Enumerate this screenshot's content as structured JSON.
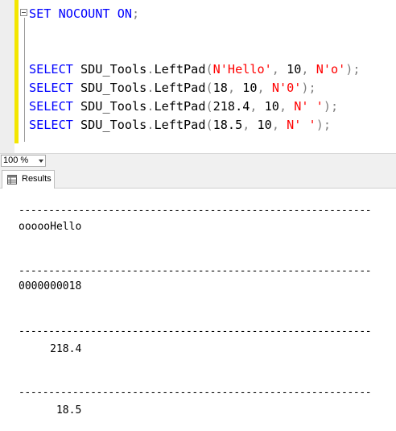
{
  "editor": {
    "lines": [
      {
        "id": "l0",
        "tokens": [
          {
            "t": "SET NOCOUNT ON",
            "c": "kw"
          },
          {
            "t": ";",
            "c": "op"
          }
        ]
      },
      {
        "id": "l1",
        "tokens": [
          {
            "t": "SELECT ",
            "c": "kw"
          },
          {
            "t": "SDU_Tools",
            "c": "num"
          },
          {
            "t": ".",
            "c": "op"
          },
          {
            "t": "LeftPad",
            "c": "num"
          },
          {
            "t": "(",
            "c": "op"
          },
          {
            "t": "N'Hello'",
            "c": "str"
          },
          {
            "t": ", ",
            "c": "op"
          },
          {
            "t": "10",
            "c": "num"
          },
          {
            "t": ", ",
            "c": "op"
          },
          {
            "t": "N'o'",
            "c": "str"
          },
          {
            "t": ");",
            "c": "op"
          }
        ]
      },
      {
        "id": "l2",
        "tokens": [
          {
            "t": "SELECT ",
            "c": "kw"
          },
          {
            "t": "SDU_Tools",
            "c": "num"
          },
          {
            "t": ".",
            "c": "op"
          },
          {
            "t": "LeftPad",
            "c": "num"
          },
          {
            "t": "(",
            "c": "op"
          },
          {
            "t": "18",
            "c": "num"
          },
          {
            "t": ", ",
            "c": "op"
          },
          {
            "t": "10",
            "c": "num"
          },
          {
            "t": ", ",
            "c": "op"
          },
          {
            "t": "N'0'",
            "c": "str"
          },
          {
            "t": ");",
            "c": "op"
          }
        ]
      },
      {
        "id": "l3",
        "tokens": [
          {
            "t": "SELECT ",
            "c": "kw"
          },
          {
            "t": "SDU_Tools",
            "c": "num"
          },
          {
            "t": ".",
            "c": "op"
          },
          {
            "t": "LeftPad",
            "c": "num"
          },
          {
            "t": "(",
            "c": "op"
          },
          {
            "t": "218.4",
            "c": "num"
          },
          {
            "t": ", ",
            "c": "op"
          },
          {
            "t": "10",
            "c": "num"
          },
          {
            "t": ", ",
            "c": "op"
          },
          {
            "t": "N' '",
            "c": "str"
          },
          {
            "t": ");",
            "c": "op"
          }
        ]
      },
      {
        "id": "l4",
        "tokens": [
          {
            "t": "SELECT ",
            "c": "kw"
          },
          {
            "t": "SDU_Tools",
            "c": "num"
          },
          {
            "t": ".",
            "c": "op"
          },
          {
            "t": "LeftPad",
            "c": "num"
          },
          {
            "t": "(",
            "c": "op"
          },
          {
            "t": "18.5",
            "c": "num"
          },
          {
            "t": ", ",
            "c": "op"
          },
          {
            "t": "10",
            "c": "num"
          },
          {
            "t": ", ",
            "c": "op"
          },
          {
            "t": "N' '",
            "c": "str"
          },
          {
            "t": ");",
            "c": "op"
          }
        ]
      }
    ]
  },
  "zoom": {
    "value": "100 %"
  },
  "results_tab": {
    "label": "Results",
    "icon": "results-grid-icon"
  },
  "results": {
    "separator": "-----------------------------------------------------------",
    "sets": [
      {
        "value": "oooooHello"
      },
      {
        "value": "0000000018"
      },
      {
        "value": "     218.4"
      },
      {
        "value": "      18.5"
      }
    ]
  },
  "colors": {
    "keyword": "#0000ff",
    "string": "#ff0000",
    "operator": "#808080",
    "change_bar": "#f3e600"
  }
}
